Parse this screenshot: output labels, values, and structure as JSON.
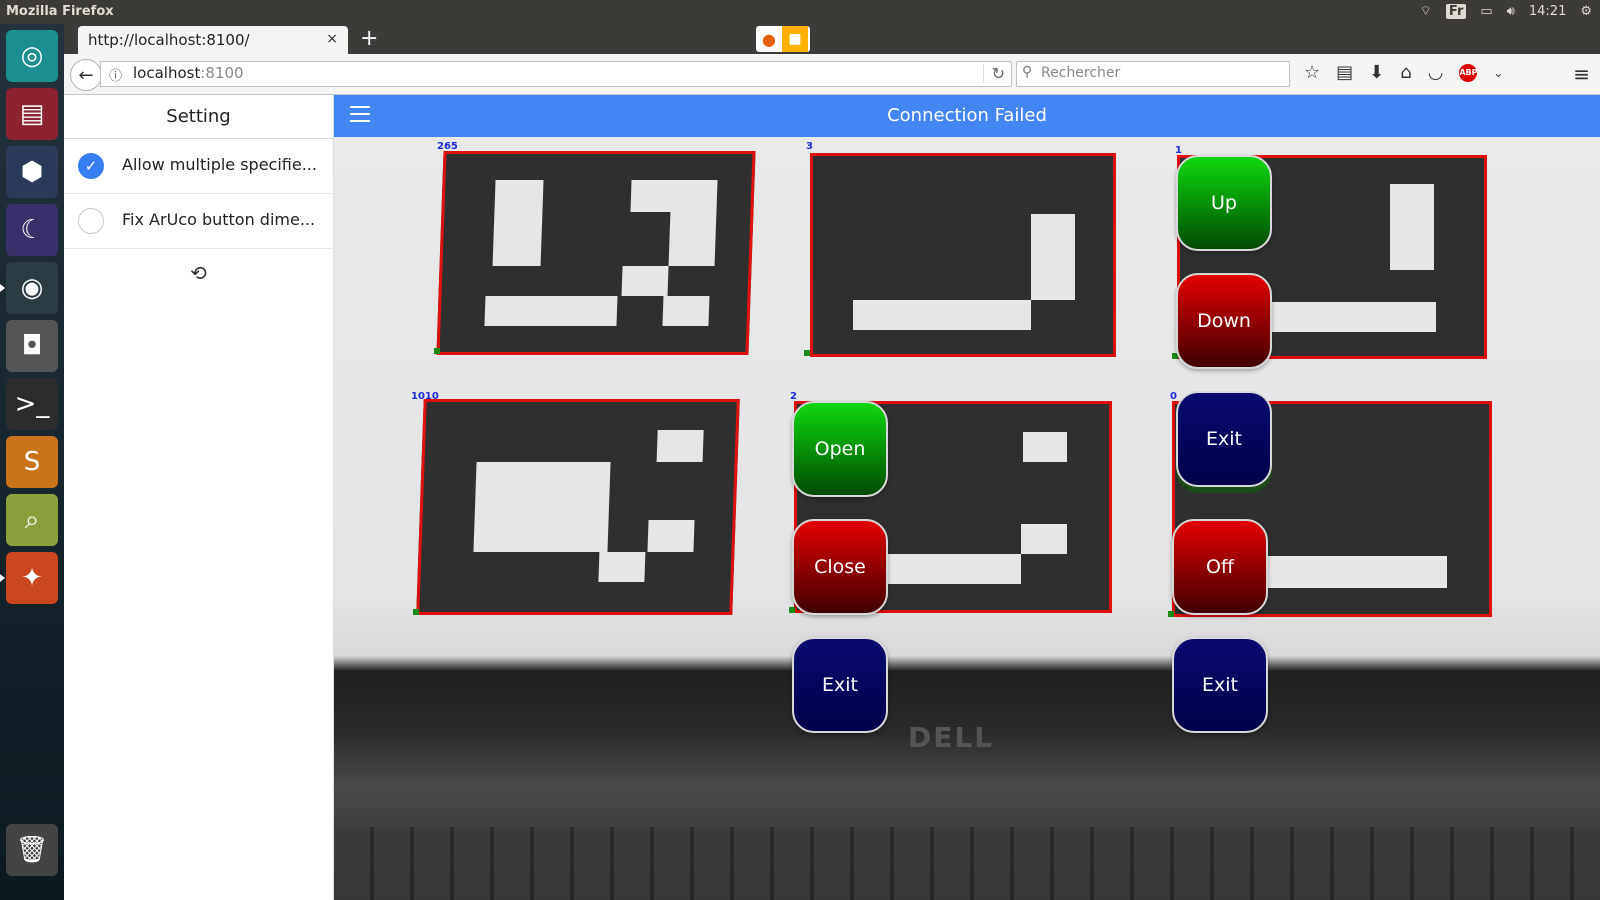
{
  "os": {
    "window_title": "Mozilla Firefox",
    "language": "Fr",
    "clock": "14:21"
  },
  "launcher": {
    "items": [
      "ubuntu-dash-icon",
      "file-cabinet-icon",
      "cube-icon",
      "eclipse-icon",
      "chrome-icon",
      "camera-icon",
      "terminal-icon",
      "sublime-icon",
      "image-viewer-icon",
      "firefox-icon",
      "trash-icon"
    ]
  },
  "browser": {
    "tab_title": "http://localhost:8100/",
    "tab_close": "×",
    "new_tab": "+",
    "url_host": "localhost",
    "url_port": ":8100",
    "search_placeholder": "Rechercher"
  },
  "app": {
    "sidebar_title": "Setting",
    "settings": [
      {
        "label": "Allow multiple specifie...",
        "checked": true
      },
      {
        "label": "Fix ArUco button dime...",
        "checked": false
      }
    ],
    "header_title": "Connection Failed",
    "colors": {
      "header": "#4286f5",
      "marker_border": "#e01010",
      "marker_id": "#1a2bd8"
    }
  },
  "markers": [
    {
      "id": "265"
    },
    {
      "id": "3"
    },
    {
      "id": "1"
    },
    {
      "id": "1010"
    },
    {
      "id": "2"
    },
    {
      "id": "0"
    }
  ],
  "overlay_buttons": {
    "up": "Up",
    "down": "Down",
    "exit1": "Exit",
    "open": "Open",
    "close": "Close",
    "exit2": "Exit",
    "off": "Off",
    "exit3": "Exit"
  },
  "background_text": {
    "brand": "DELL"
  }
}
